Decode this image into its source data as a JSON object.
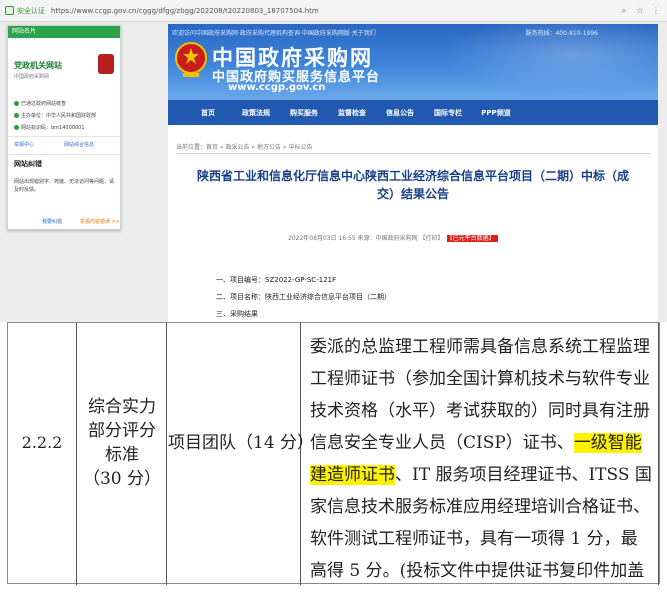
{
  "browser": {
    "security_badge": "安全认证",
    "url": "https://www.ccgp.gov.cn/cggg/dfgg/zbgg/202208/t20220803_18707504.htm",
    "actions": [
      "zoom-icon",
      "star-icon",
      "menu-icon"
    ]
  },
  "banner": {
    "top_links": "欢迎访问中国政府采购网·政府采购代理机构查询·中国政府采购网版·关于我们",
    "phone": "服务热线：400-810-1996",
    "brand_main": "中国政府采购网",
    "brand_sub": "中国政府购买服务信息平台",
    "brand_url": "www.ccgp.gov.cn"
  },
  "nav": {
    "items": [
      "首页",
      "政策法规",
      "购买服务",
      "监督检查",
      "信息公告",
      "国际专栏",
      "PPP频道"
    ]
  },
  "article": {
    "breadcrumb": "当前位置：首页 » 政采公告 » 地方公告 » 中标公告",
    "title_line1": "陕西省工业和信息化厅信息中心陕西工业经济综合信息平台项目（二期）中标（成",
    "title_line2": "交）结果公告",
    "meta": "2022年08月03日 16:55  来源：中国政府采购网  【打印】",
    "meta_tag": "【已元平台数据】",
    "item1": "一、项目编号：SZ2022-GP-SC-121F",
    "item2": "二、项目名称：陕西工业经济综合信息平台项目（二期）",
    "item3": "三、采购结果"
  },
  "popup": {
    "header": "网站名片",
    "site_name": "党政机关网站",
    "site_desc": "中国政府采购网",
    "rows": [
      "已通过政府网站核查",
      "主办单位：中华人民共和国财政部",
      "网站标识码：bm14000001"
    ],
    "link_left": "举报中心",
    "link_right": "网站综合信息",
    "section_title": "网站纠错",
    "section_text": "网站出现错别字、死链、无法访问等问题，请及时反馈。",
    "footer_left": "我要纠错",
    "footer_right": "举报内容错误 >>"
  },
  "table_crop": {
    "item_no": "2.2.2",
    "category": [
      "综合实力",
      "部分评分",
      "标准",
      "（30 分）"
    ],
    "factor": "项目团队（14 分）",
    "text_before": "委派的总监理工程师需具备信息系统工程监理工程师证书（参加全国计算机技术与软件专业技术资格（水平）考试获取的）同时具有注册信息安全专业人员（CISP）证书、",
    "highlight": "一级智能建造师证书",
    "text_after": "、IT 服务项目经理证书、ITSS 国家信息技术服务标准应用经理培训合格证书、软件测试工程师证书，具有一项得 1 分，最高得 5 分。(投标文件中提供证书复印件加盖公章)。",
    "highlight_color": "#fff200"
  }
}
